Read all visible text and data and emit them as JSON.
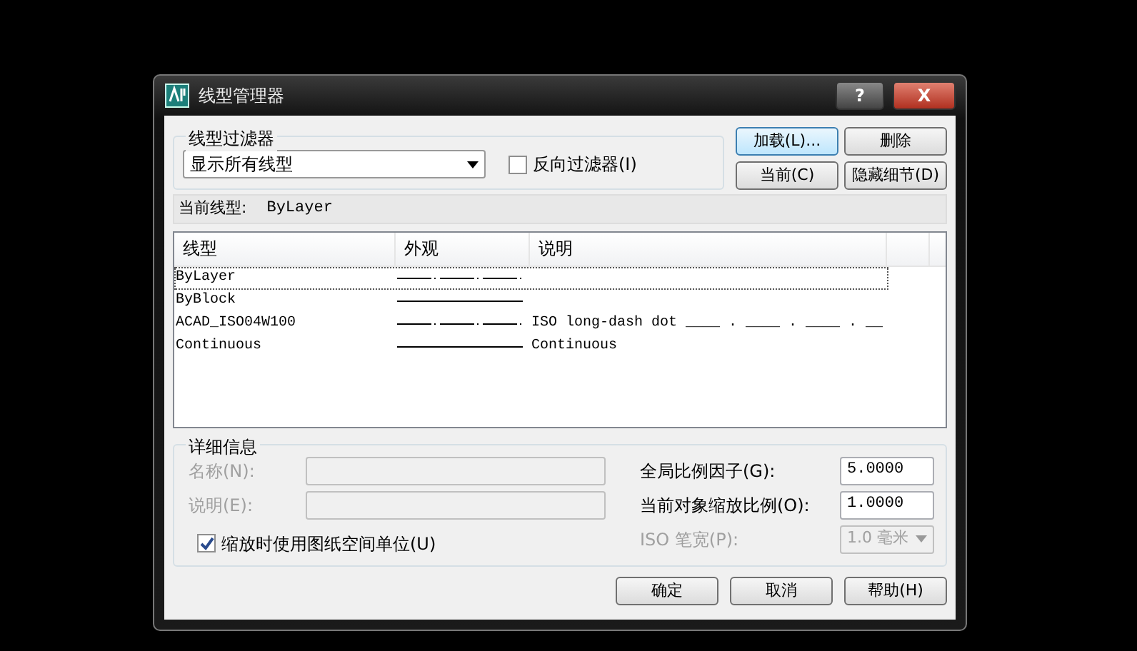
{
  "window": {
    "title": "线型管理器",
    "help_button": "?",
    "close_button": "X"
  },
  "filter": {
    "group_label": "线型过滤器",
    "dropdown_value": "显示所有线型",
    "invert": {
      "label": "反向过滤器(I)",
      "checked": false
    }
  },
  "buttons_top": [
    {
      "label": "加载(L)...",
      "focused": true
    },
    {
      "label": "删除",
      "focused": false
    },
    {
      "label": "当前(C)",
      "focused": false
    },
    {
      "label": "隐藏细节(D)",
      "focused": false
    }
  ],
  "current_linetype": {
    "label": "当前线型:",
    "value": "ByLayer"
  },
  "table": {
    "columns": [
      "线型",
      "外观",
      "说明"
    ],
    "rows": [
      {
        "name": "ByLayer",
        "kind": "dashdot",
        "description": "",
        "selected": true
      },
      {
        "name": "ByBlock",
        "kind": "solid",
        "description": "",
        "selected": false
      },
      {
        "name": "ACAD_ISO04W100",
        "kind": "dashdot",
        "description": "ISO long-dash dot ____ . ____ . ____ . __",
        "selected": false
      },
      {
        "name": "Continuous",
        "kind": "solid",
        "description": "Continuous",
        "selected": false
      }
    ]
  },
  "details": {
    "group_label": "详细信息",
    "left_fields": [
      {
        "label": "名称(N):",
        "disabled": true
      },
      {
        "label": "说明(E):",
        "disabled": true
      }
    ],
    "paper_space": {
      "label": "缩放时使用图纸空间单位(U)",
      "checked": true
    },
    "right_fields": [
      {
        "label": "全局比例因子(G):",
        "value": "5.0000",
        "kind": "text",
        "disabled": false
      },
      {
        "label": "当前对象缩放比例(O):",
        "value": "1.0000",
        "kind": "text",
        "disabled": false
      },
      {
        "label": "ISO 笔宽(P):",
        "value": "1.0 毫米",
        "kind": "select",
        "disabled": true
      }
    ]
  },
  "buttons_bottom": [
    "确定",
    "取消",
    "帮助(H)"
  ]
}
